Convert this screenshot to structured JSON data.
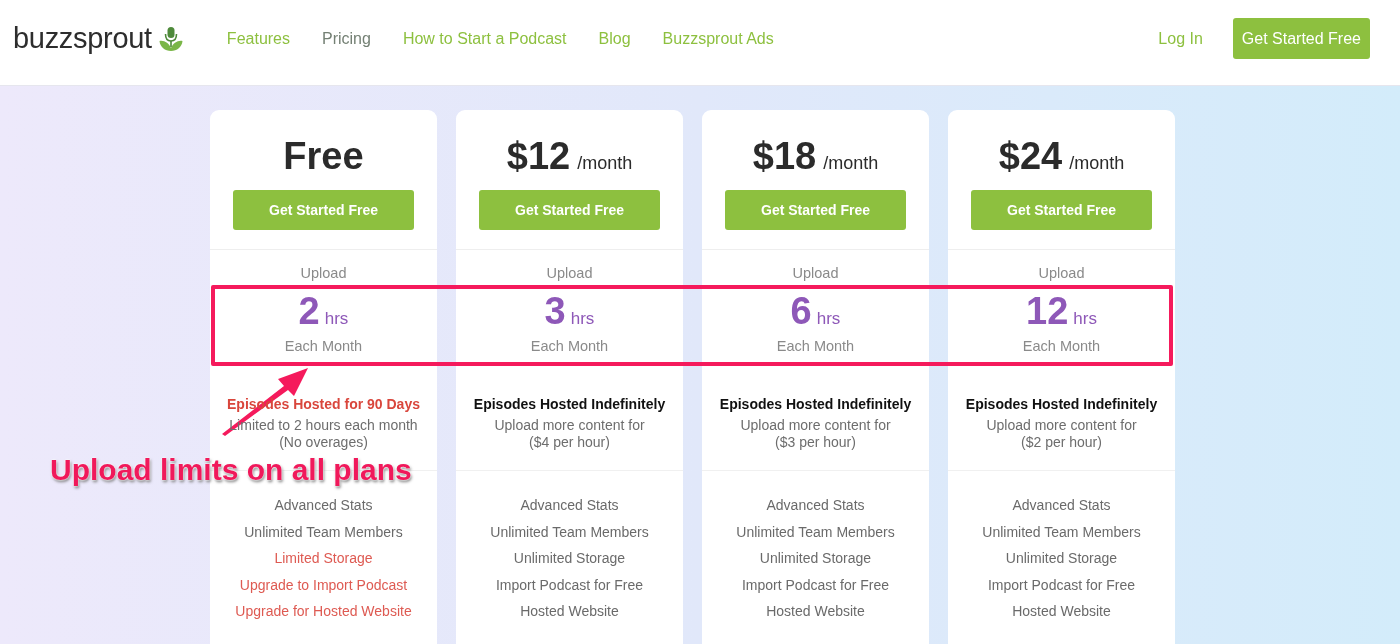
{
  "header": {
    "logo": "buzzsprout",
    "nav": [
      {
        "label": "Features",
        "selected": false
      },
      {
        "label": "Pricing",
        "selected": true
      },
      {
        "label": "How to Start a Podcast",
        "selected": false
      },
      {
        "label": "Blog",
        "selected": false
      },
      {
        "label": "Buzzsprout Ads",
        "selected": false
      }
    ],
    "login": "Log In",
    "cta": "Get Started Free"
  },
  "plans": [
    {
      "price": "Free",
      "button": "Get Started Free",
      "upload_label": "Upload",
      "upload_amount": "2",
      "upload_unit": "hrs",
      "upload_frequency": "Each Month",
      "hosting": {
        "title": "Episodes Hosted for 90 Days",
        "limited": true
      },
      "notes": [
        "Limited to 2 hours each month",
        "(No overages)"
      ],
      "features": [
        {
          "text": "Advanced Stats",
          "limited": false
        },
        {
          "text": "Unlimited Team Members",
          "limited": false
        },
        {
          "text": "Limited Storage",
          "limited": true
        },
        {
          "text": "Upgrade to Import Podcast",
          "limited": true
        },
        {
          "text": "Upgrade for Hosted Website",
          "limited": true
        }
      ]
    },
    {
      "price": "$12",
      "period": "/month",
      "button": "Get Started Free",
      "upload_label": "Upload",
      "upload_amount": "3",
      "upload_unit": "hrs",
      "upload_frequency": "Each Month",
      "hosting": {
        "title": "Episodes Hosted Indefinitely",
        "limited": false
      },
      "notes": [
        "Upload more content for",
        "($4 per hour)"
      ],
      "features": [
        {
          "text": "Advanced Stats",
          "limited": false
        },
        {
          "text": "Unlimited Team Members",
          "limited": false
        },
        {
          "text": "Unlimited Storage",
          "limited": false
        },
        {
          "text": "Import Podcast for Free",
          "limited": false
        },
        {
          "text": "Hosted Website",
          "limited": false
        }
      ]
    },
    {
      "price": "$18",
      "period": "/month",
      "button": "Get Started Free",
      "upload_label": "Upload",
      "upload_amount": "6",
      "upload_unit": "hrs",
      "upload_frequency": "Each Month",
      "hosting": {
        "title": "Episodes Hosted Indefinitely",
        "limited": false
      },
      "notes": [
        "Upload more content for",
        "($3 per hour)"
      ],
      "features": [
        {
          "text": "Advanced Stats",
          "limited": false
        },
        {
          "text": "Unlimited Team Members",
          "limited": false
        },
        {
          "text": "Unlimited Storage",
          "limited": false
        },
        {
          "text": "Import Podcast for Free",
          "limited": false
        },
        {
          "text": "Hosted Website",
          "limited": false
        }
      ]
    },
    {
      "price": "$24",
      "period": "/month",
      "button": "Get Started Free",
      "upload_label": "Upload",
      "upload_amount": "12",
      "upload_unit": "hrs",
      "upload_frequency": "Each Month",
      "hosting": {
        "title": "Episodes Hosted Indefinitely",
        "limited": false
      },
      "notes": [
        "Upload more content for",
        "($2 per hour)"
      ],
      "features": [
        {
          "text": "Advanced Stats",
          "limited": false
        },
        {
          "text": "Unlimited Team Members",
          "limited": false
        },
        {
          "text": "Unlimited Storage",
          "limited": false
        },
        {
          "text": "Import Podcast for Free",
          "limited": false
        },
        {
          "text": "Hosted Website",
          "limited": false
        }
      ]
    }
  ],
  "annotation": {
    "label": "Upload limits on all plans"
  }
}
